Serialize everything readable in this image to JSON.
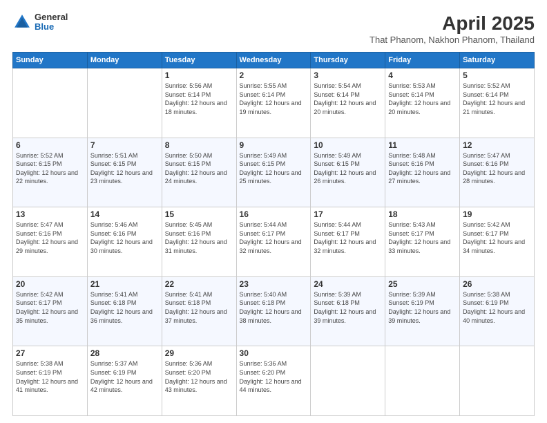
{
  "header": {
    "logo": {
      "general": "General",
      "blue": "Blue"
    },
    "title": "April 2025",
    "subtitle": "That Phanom, Nakhon Phanom, Thailand"
  },
  "weekdays": [
    "Sunday",
    "Monday",
    "Tuesday",
    "Wednesday",
    "Thursday",
    "Friday",
    "Saturday"
  ],
  "weeks": [
    [
      null,
      null,
      {
        "day": "1",
        "sunrise": "Sunrise: 5:56 AM",
        "sunset": "Sunset: 6:14 PM",
        "daylight": "Daylight: 12 hours and 18 minutes."
      },
      {
        "day": "2",
        "sunrise": "Sunrise: 5:55 AM",
        "sunset": "Sunset: 6:14 PM",
        "daylight": "Daylight: 12 hours and 19 minutes."
      },
      {
        "day": "3",
        "sunrise": "Sunrise: 5:54 AM",
        "sunset": "Sunset: 6:14 PM",
        "daylight": "Daylight: 12 hours and 20 minutes."
      },
      {
        "day": "4",
        "sunrise": "Sunrise: 5:53 AM",
        "sunset": "Sunset: 6:14 PM",
        "daylight": "Daylight: 12 hours and 20 minutes."
      },
      {
        "day": "5",
        "sunrise": "Sunrise: 5:52 AM",
        "sunset": "Sunset: 6:14 PM",
        "daylight": "Daylight: 12 hours and 21 minutes."
      }
    ],
    [
      {
        "day": "6",
        "sunrise": "Sunrise: 5:52 AM",
        "sunset": "Sunset: 6:15 PM",
        "daylight": "Daylight: 12 hours and 22 minutes."
      },
      {
        "day": "7",
        "sunrise": "Sunrise: 5:51 AM",
        "sunset": "Sunset: 6:15 PM",
        "daylight": "Daylight: 12 hours and 23 minutes."
      },
      {
        "day": "8",
        "sunrise": "Sunrise: 5:50 AM",
        "sunset": "Sunset: 6:15 PM",
        "daylight": "Daylight: 12 hours and 24 minutes."
      },
      {
        "day": "9",
        "sunrise": "Sunrise: 5:49 AM",
        "sunset": "Sunset: 6:15 PM",
        "daylight": "Daylight: 12 hours and 25 minutes."
      },
      {
        "day": "10",
        "sunrise": "Sunrise: 5:49 AM",
        "sunset": "Sunset: 6:15 PM",
        "daylight": "Daylight: 12 hours and 26 minutes."
      },
      {
        "day": "11",
        "sunrise": "Sunrise: 5:48 AM",
        "sunset": "Sunset: 6:16 PM",
        "daylight": "Daylight: 12 hours and 27 minutes."
      },
      {
        "day": "12",
        "sunrise": "Sunrise: 5:47 AM",
        "sunset": "Sunset: 6:16 PM",
        "daylight": "Daylight: 12 hours and 28 minutes."
      }
    ],
    [
      {
        "day": "13",
        "sunrise": "Sunrise: 5:47 AM",
        "sunset": "Sunset: 6:16 PM",
        "daylight": "Daylight: 12 hours and 29 minutes."
      },
      {
        "day": "14",
        "sunrise": "Sunrise: 5:46 AM",
        "sunset": "Sunset: 6:16 PM",
        "daylight": "Daylight: 12 hours and 30 minutes."
      },
      {
        "day": "15",
        "sunrise": "Sunrise: 5:45 AM",
        "sunset": "Sunset: 6:16 PM",
        "daylight": "Daylight: 12 hours and 31 minutes."
      },
      {
        "day": "16",
        "sunrise": "Sunrise: 5:44 AM",
        "sunset": "Sunset: 6:17 PM",
        "daylight": "Daylight: 12 hours and 32 minutes."
      },
      {
        "day": "17",
        "sunrise": "Sunrise: 5:44 AM",
        "sunset": "Sunset: 6:17 PM",
        "daylight": "Daylight: 12 hours and 32 minutes."
      },
      {
        "day": "18",
        "sunrise": "Sunrise: 5:43 AM",
        "sunset": "Sunset: 6:17 PM",
        "daylight": "Daylight: 12 hours and 33 minutes."
      },
      {
        "day": "19",
        "sunrise": "Sunrise: 5:42 AM",
        "sunset": "Sunset: 6:17 PM",
        "daylight": "Daylight: 12 hours and 34 minutes."
      }
    ],
    [
      {
        "day": "20",
        "sunrise": "Sunrise: 5:42 AM",
        "sunset": "Sunset: 6:17 PM",
        "daylight": "Daylight: 12 hours and 35 minutes."
      },
      {
        "day": "21",
        "sunrise": "Sunrise: 5:41 AM",
        "sunset": "Sunset: 6:18 PM",
        "daylight": "Daylight: 12 hours and 36 minutes."
      },
      {
        "day": "22",
        "sunrise": "Sunrise: 5:41 AM",
        "sunset": "Sunset: 6:18 PM",
        "daylight": "Daylight: 12 hours and 37 minutes."
      },
      {
        "day": "23",
        "sunrise": "Sunrise: 5:40 AM",
        "sunset": "Sunset: 6:18 PM",
        "daylight": "Daylight: 12 hours and 38 minutes."
      },
      {
        "day": "24",
        "sunrise": "Sunrise: 5:39 AM",
        "sunset": "Sunset: 6:18 PM",
        "daylight": "Daylight: 12 hours and 39 minutes."
      },
      {
        "day": "25",
        "sunrise": "Sunrise: 5:39 AM",
        "sunset": "Sunset: 6:19 PM",
        "daylight": "Daylight: 12 hours and 39 minutes."
      },
      {
        "day": "26",
        "sunrise": "Sunrise: 5:38 AM",
        "sunset": "Sunset: 6:19 PM",
        "daylight": "Daylight: 12 hours and 40 minutes."
      }
    ],
    [
      {
        "day": "27",
        "sunrise": "Sunrise: 5:38 AM",
        "sunset": "Sunset: 6:19 PM",
        "daylight": "Daylight: 12 hours and 41 minutes."
      },
      {
        "day": "28",
        "sunrise": "Sunrise: 5:37 AM",
        "sunset": "Sunset: 6:19 PM",
        "daylight": "Daylight: 12 hours and 42 minutes."
      },
      {
        "day": "29",
        "sunrise": "Sunrise: 5:36 AM",
        "sunset": "Sunset: 6:20 PM",
        "daylight": "Daylight: 12 hours and 43 minutes."
      },
      {
        "day": "30",
        "sunrise": "Sunrise: 5:36 AM",
        "sunset": "Sunset: 6:20 PM",
        "daylight": "Daylight: 12 hours and 44 minutes."
      },
      null,
      null,
      null
    ]
  ]
}
